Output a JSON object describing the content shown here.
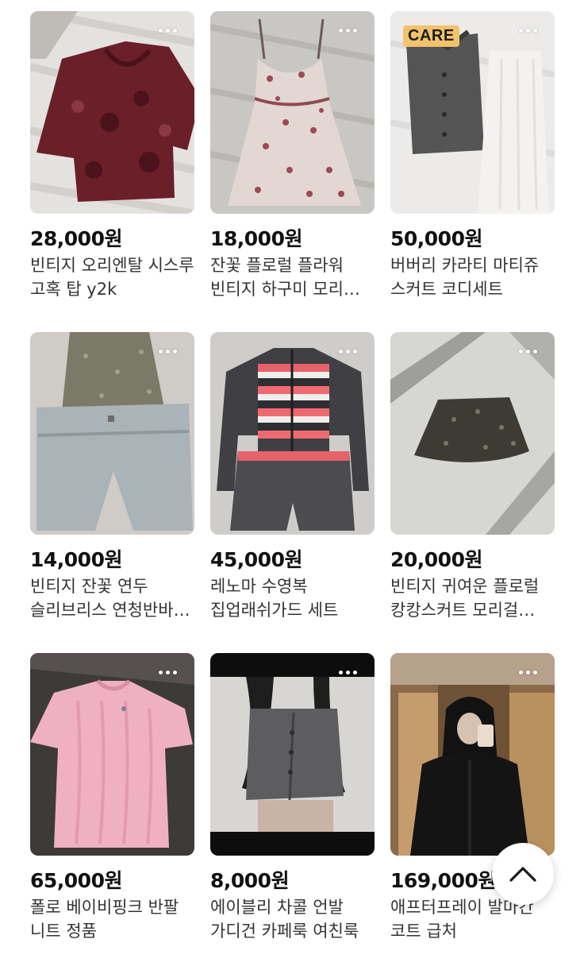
{
  "products": [
    {
      "price": "28,000원",
      "title": "빈티지 오리엔탈 시스루 고혹 탑 y2k",
      "image": "burgundy-sheer-floral-top"
    },
    {
      "price": "18,000원",
      "title": "잔꽃 플로럴 플라워 빈티지 하구미 모리걸 원피스",
      "image": "floral-cami-dress"
    },
    {
      "price": "50,000원",
      "title": "버버리 카라티 마티쥬 스커트 코디세트",
      "image": "gray-cardigan-white-skirt",
      "tag": "CARE"
    },
    {
      "price": "14,000원",
      "title": "빈티지 잔꽃 연두 슬리브리스 연청반바지 세트",
      "image": "cami-and-denim-shorts"
    },
    {
      "price": "45,000원",
      "title": "레노마 수영복 집업래쉬가드 세트",
      "image": "striped-rashguard-set"
    },
    {
      "price": "20,000원",
      "title": "빈티지 귀여운 플로럴 캉캉스커트 모리걸 하구미",
      "image": "floral-cancan-skirt"
    },
    {
      "price": "65,000원",
      "title": "폴로 베이비핑크 반팔 니트 정품",
      "image": "pink-cable-knit"
    },
    {
      "price": "8,000원",
      "title": "에이블리 차콜 언발 가디건 카페룩 여친룩",
      "image": "charcoal-cardigan"
    },
    {
      "price": "169,000원",
      "title": "애프터프레이 발마칸 코트 급처",
      "image": "black-coat-mirror"
    }
  ],
  "more_menu_icon": "more-horizontal-icon",
  "scroll_top": {
    "icon": "chevron-up-icon"
  }
}
